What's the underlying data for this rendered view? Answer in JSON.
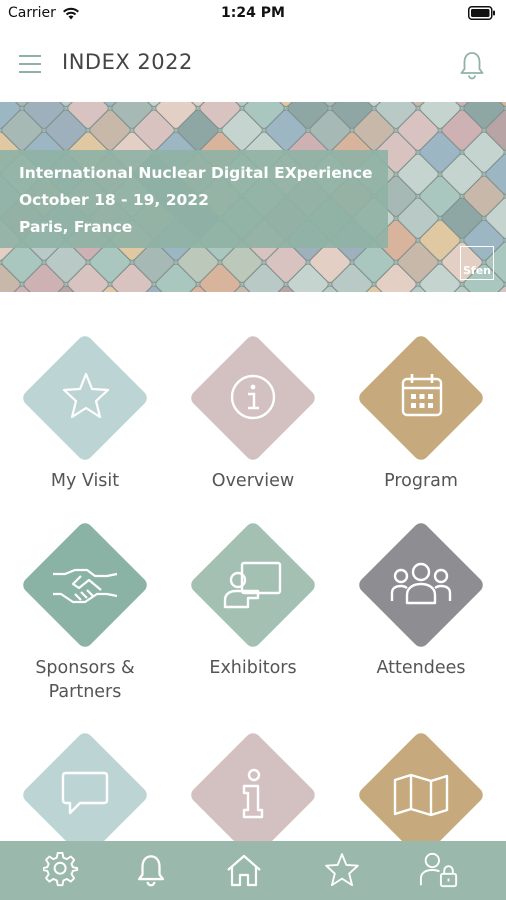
{
  "status_bar": {
    "carrier": "Carrier",
    "time": "1:24 PM"
  },
  "header": {
    "title": "INDEX 2022",
    "menu_icon": "hamburger-menu-icon",
    "notification_icon": "bell-icon"
  },
  "banner": {
    "line1": "International Nuclear Digital EXperience",
    "line2": "October 18 - 19, 2022",
    "line3": "Paris, France",
    "logo_text": "Sfen"
  },
  "tiles": [
    {
      "label": "My Visit",
      "icon": "star-icon",
      "color": "#bdd4d5"
    },
    {
      "label": "Overview",
      "icon": "info-circle-icon",
      "color": "#d3c1c2"
    },
    {
      "label": "Program",
      "icon": "calendar-icon",
      "color": "#c6a97c"
    },
    {
      "label": "Sponsors &",
      "label2": "Partners",
      "icon": "handshake-icon",
      "color": "#8ab2a5"
    },
    {
      "label": "Exhibitors",
      "icon": "presenter-icon",
      "color": "#a3c0b2"
    },
    {
      "label": "Attendees",
      "icon": "people-icon",
      "color": "#8e8e92"
    },
    {
      "label": "",
      "icon": "chat-bubble-icon",
      "color": "#bdd4d5"
    },
    {
      "label": "",
      "icon": "info-icon",
      "color": "#d3c1c2"
    },
    {
      "label": "",
      "icon": "map-icon",
      "color": "#c6a97c"
    }
  ],
  "bottom_bar": {
    "color": "#9ab8ab",
    "tabs": [
      "gear-icon",
      "bell-icon",
      "home-icon",
      "star-icon",
      "user-lock-icon"
    ]
  },
  "colors": {
    "accent": "#8fb2a5",
    "text": "#555555"
  }
}
